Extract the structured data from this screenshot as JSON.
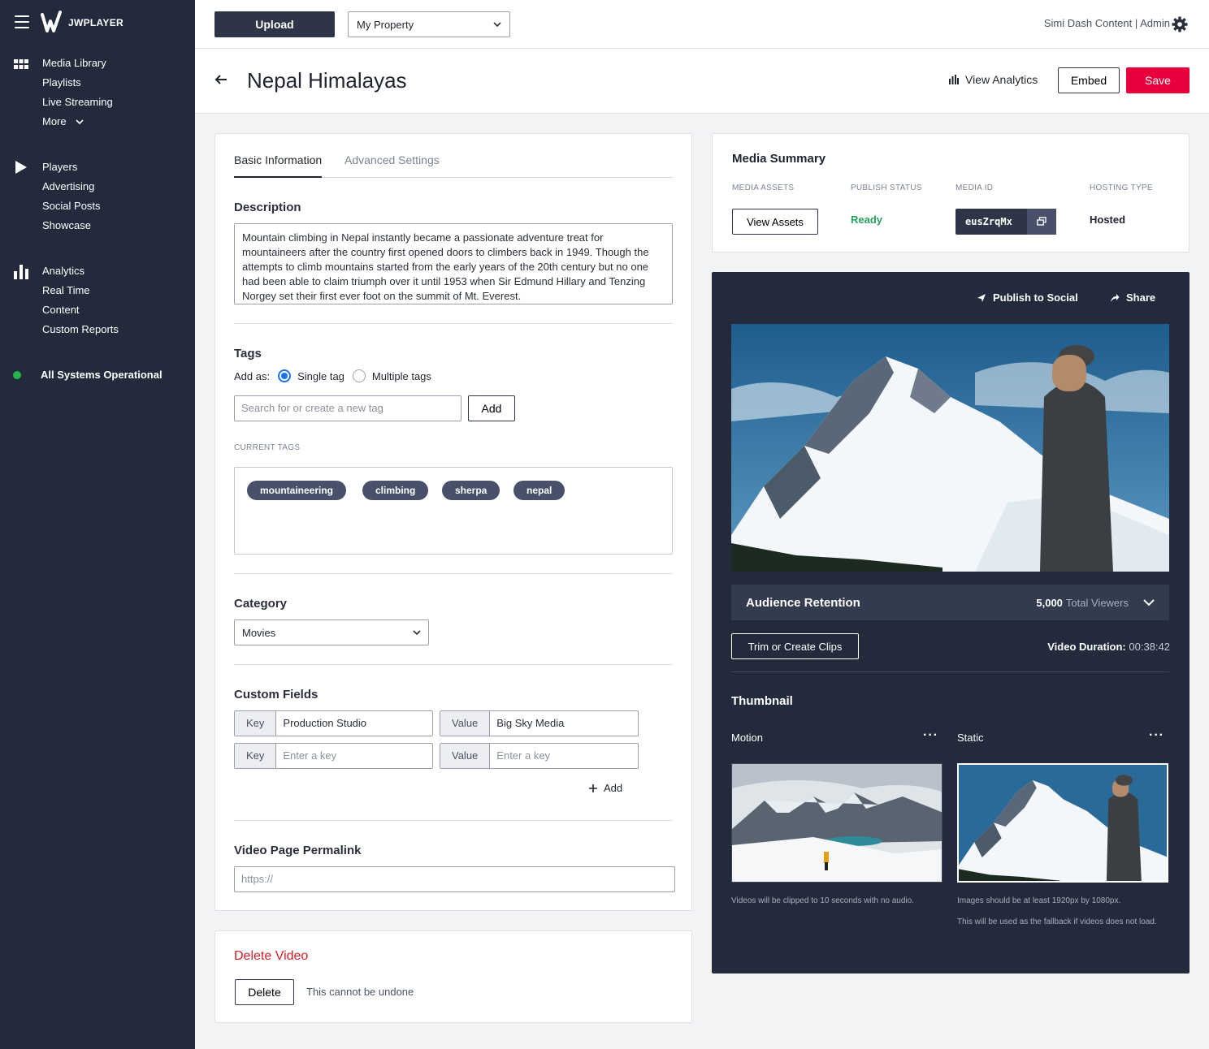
{
  "app": {
    "logo_text": "JWPLAYER"
  },
  "sidebar": {
    "groups": [
      {
        "icon": "grid-icon",
        "items": [
          "Media Library",
          "Playlists",
          "Live Streaming",
          "More"
        ]
      },
      {
        "icon": "play-icon",
        "items": [
          "Players",
          "Advertising",
          "Social Posts",
          "Showcase"
        ]
      },
      {
        "icon": "bar-chart-icon",
        "items": [
          "Analytics",
          "Real Time",
          "Content",
          "Custom Reports"
        ]
      }
    ],
    "status": "All Systems Operational",
    "status_color": "#26b34c"
  },
  "topbar": {
    "upload_label": "Upload",
    "property_value": "My Property",
    "user_label": "Simi Dash Content | Admin"
  },
  "header": {
    "title": "Nepal Himalayas",
    "view_analytics": "View Analytics",
    "embed": "Embed",
    "save": "Save",
    "save_color": "#e8003d"
  },
  "form": {
    "tabs": [
      "Basic Information",
      "Advanced Settings"
    ],
    "description_label": "Description",
    "description": "Mountain climbing in Nepal instantly became a passionate adventure treat for mountaineers after the country first opened doors to climbers back in 1949. Though the attempts to climb mountains started from the early years of the 20th century but no one had been able to claim triumph over it until 1953 when Sir Edmund Hillary and Tenzing Norgey set their first ever foot on the summit of Mt. Everest.",
    "tags_label": "Tags",
    "add_as_label": "Add as:",
    "single_tag": "Single tag",
    "multiple_tags": "Multiple tags",
    "tag_placeholder": "Search for or create a new tag",
    "add_button": "Add",
    "current_tags_label": "CURRENT TAGS",
    "tags": [
      "mountaineering",
      "climbing",
      "sherpa",
      "nepal"
    ],
    "category_label": "Category",
    "category_value": "Movies",
    "custom_fields_label": "Custom Fields",
    "custom_fields": [
      {
        "key_label": "Key",
        "key": "Production Studio",
        "value_label": "Value",
        "value": "Big Sky Media"
      },
      {
        "key_label": "Key",
        "key_placeholder": "Enter a key",
        "value_label": "Value",
        "value_placeholder": "Enter a key"
      }
    ],
    "add_field": "Add",
    "permalink_label": "Video Page Permalink",
    "permalink_placeholder": "https://"
  },
  "delete": {
    "title": "Delete Video",
    "button": "Delete",
    "note": "This cannot be undone"
  },
  "summary": {
    "title": "Media Summary",
    "columns": [
      "MEDIA ASSETS",
      "PUBLISH STATUS",
      "MEDIA ID",
      "HOSTING TYPE"
    ],
    "view_assets": "View Assets",
    "status": "Ready",
    "media_id": "eusZrqMx",
    "hosting": "Hosted"
  },
  "player": {
    "publish_social": "Publish to Social",
    "share": "Share",
    "retention_title": "Audience Retention",
    "viewers_count": "5,000",
    "viewers_label": "Total Viewers",
    "trim": "Trim or Create Clips",
    "duration_label": "Video Duration:",
    "duration_value": "00:38:42",
    "thumbnail_title": "Thumbnail",
    "motion_label": "Motion",
    "static_label": "Static",
    "motion_note": "Videos will be clipped to 10 seconds with no audio.",
    "static_note_1": "Images should be at least 1920px by 1080px.",
    "static_note_2": "This will be used as the fallback if videos does not load."
  }
}
